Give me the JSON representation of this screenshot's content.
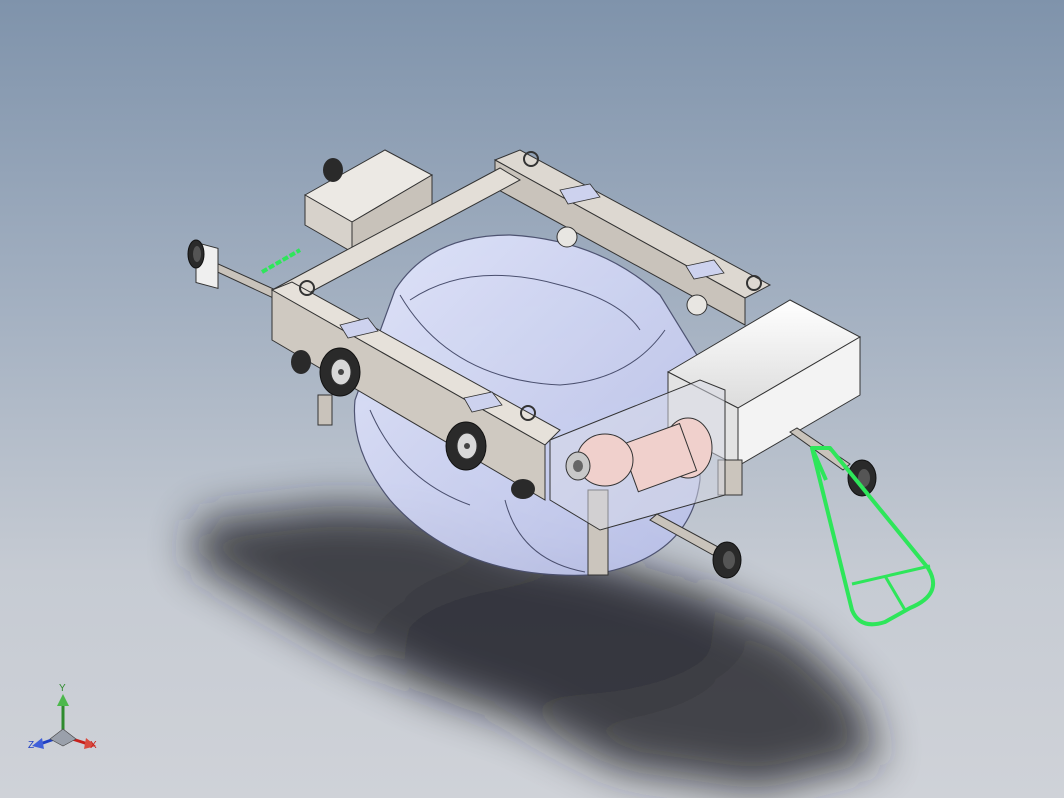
{
  "viewport": {
    "background_top": "#7f93ab",
    "background_bottom": "#cfd2d8"
  },
  "model": {
    "frame_color": "#d4cec6",
    "frame_edge_color": "#3a3a3a",
    "tank_color": "#c7cdee",
    "motor_color": "#f0d0cc",
    "enclosure_color": "#f2f2f2",
    "highlight_color": "#2ee65a",
    "wheel_color": "#2a2a2a"
  },
  "triad": {
    "x_label": "X",
    "y_label": "Y",
    "z_label": "Z",
    "x_color": "#c8201c",
    "y_color": "#2e8b2e",
    "z_color": "#1f3fc4"
  }
}
